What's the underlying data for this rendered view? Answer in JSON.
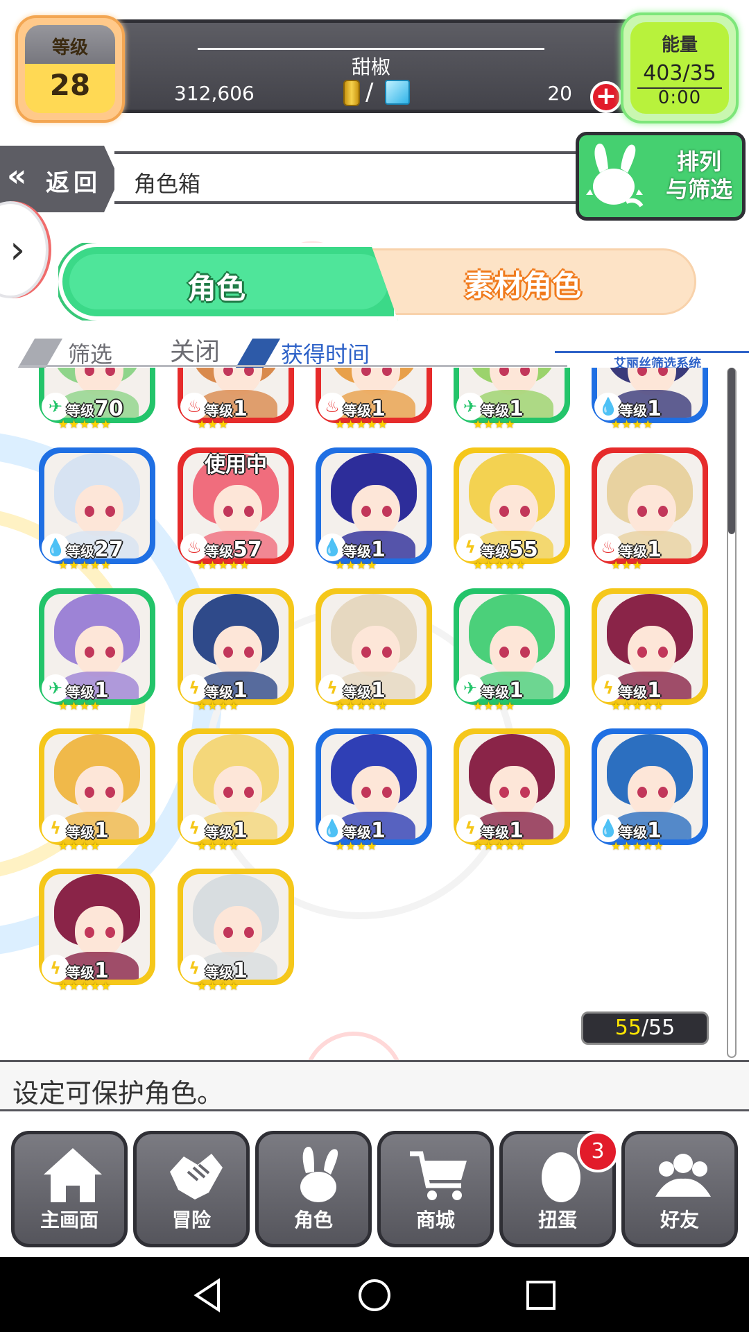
{
  "player": {
    "name": "甜椒",
    "level_label": "等级",
    "level": "28",
    "coins": "312,606",
    "gems": "20",
    "currency_separator": "/"
  },
  "energy": {
    "label": "能量",
    "value": "403/35",
    "timer": "0:00"
  },
  "nav": {
    "back_label": "返回",
    "page_title": "角色箱",
    "sort_label_line1": "排列",
    "sort_label_line2": "与筛选"
  },
  "tabs": {
    "active": "角色",
    "material": "素材角色"
  },
  "filter": {
    "label": "筛选",
    "state": "关闭",
    "sort_by": "获得时间",
    "system_name": "艾丽丝筛选系统"
  },
  "characters": [
    {
      "level_label": "等级",
      "level": "70",
      "element": "wind",
      "frame": "#23c46a",
      "hair": "#8fd48a",
      "stars": "★★★★★"
    },
    {
      "level_label": "等级",
      "level": "1",
      "element": "fire",
      "frame": "#e62b2b",
      "hair": "#d98a4d",
      "stars": "★★★"
    },
    {
      "level_label": "等级",
      "level": "1",
      "element": "fire",
      "frame": "#e62b2b",
      "hair": "#e8a04a",
      "stars": "★★★★★"
    },
    {
      "level_label": "等级",
      "level": "1",
      "element": "wind",
      "frame": "#23c46a",
      "hair": "#9bd36c",
      "stars": "★★★★"
    },
    {
      "level_label": "等级",
      "level": "1",
      "element": "water",
      "frame": "#1f6fe3",
      "hair": "#3a3a7a",
      "stars": "★★★★"
    },
    {
      "level_label": "等级",
      "level": "27",
      "element": "water",
      "frame": "#1f6fe3",
      "hair": "#d7e3f2",
      "stars": "★★★★★"
    },
    {
      "level_label": "等级",
      "level": "57",
      "element": "fire",
      "frame": "#e62b2b",
      "hair": "#f06d7d",
      "stars": "★★★★★",
      "in_use": "使用中"
    },
    {
      "level_label": "等级",
      "level": "1",
      "element": "water",
      "frame": "#1f6fe3",
      "hair": "#2d2d9a",
      "stars": "★★★★"
    },
    {
      "level_label": "等级",
      "level": "55",
      "element": "thunder",
      "frame": "#f5c71a",
      "hair": "#f3d251",
      "stars": "★★★★★"
    },
    {
      "level_label": "等级",
      "level": "1",
      "element": "fire",
      "frame": "#e62b2b",
      "hair": "#e8d2a0",
      "stars": "★★★"
    },
    {
      "level_label": "等级",
      "level": "1",
      "element": "wind",
      "frame": "#23c46a",
      "hair": "#9d83d6",
      "stars": "★★★★"
    },
    {
      "level_label": "等级",
      "level": "1",
      "element": "thunder",
      "frame": "#f5c71a",
      "hair": "#2f4a8a",
      "stars": "★★★★"
    },
    {
      "level_label": "等级",
      "level": "1",
      "element": "thunder",
      "frame": "#f5c71a",
      "hair": "#e6d8c0",
      "stars": "★★★★★"
    },
    {
      "level_label": "等级",
      "level": "1",
      "element": "wind",
      "frame": "#23c46a",
      "hair": "#4bd07a",
      "stars": "★★★★"
    },
    {
      "level_label": "等级",
      "level": "1",
      "element": "thunder",
      "frame": "#f5c71a",
      "hair": "#8a2448",
      "stars": "★★★★★"
    },
    {
      "level_label": "等级",
      "level": "1",
      "element": "thunder",
      "frame": "#f5c71a",
      "hair": "#f0b94a",
      "stars": "★★★★"
    },
    {
      "level_label": "等级",
      "level": "1",
      "element": "thunder",
      "frame": "#f5c71a",
      "hair": "#f4d77a",
      "stars": "★★★★"
    },
    {
      "level_label": "等级",
      "level": "1",
      "element": "water",
      "frame": "#1f6fe3",
      "hair": "#2f3fb5",
      "stars": "★★★★"
    },
    {
      "level_label": "等级",
      "level": "1",
      "element": "thunder",
      "frame": "#f5c71a",
      "hair": "#8a2448",
      "stars": "★★★★★"
    },
    {
      "level_label": "等级",
      "level": "1",
      "element": "water",
      "frame": "#1f6fe3",
      "hair": "#2c6fc0",
      "stars": "★★★★★"
    },
    {
      "level_label": "等级",
      "level": "1",
      "element": "thunder",
      "frame": "#f5c71a",
      "hair": "#8a2448",
      "stars": "★★★★★"
    },
    {
      "level_label": "等级",
      "level": "1",
      "element": "thunder",
      "frame": "#f5c71a",
      "hair": "#d8dde0",
      "stars": "★★★★"
    }
  ],
  "count": {
    "current": "55",
    "separator": "/",
    "total": "55"
  },
  "message": "设定可保护角色。",
  "bottom_nav": [
    {
      "label": "主画面",
      "icon": "home-icon"
    },
    {
      "label": "冒险",
      "icon": "handshake-icon"
    },
    {
      "label": "角色",
      "icon": "rabbit-icon"
    },
    {
      "label": "商城",
      "icon": "cart-icon"
    },
    {
      "label": "扭蛋",
      "icon": "egg-icon"
    },
    {
      "label": "好友",
      "icon": "friends-icon"
    }
  ],
  "gacha_badge": "3",
  "element_glyphs": {
    "wind": "✈",
    "fire": "♨",
    "water": "💧",
    "thunder": "ϟ"
  }
}
